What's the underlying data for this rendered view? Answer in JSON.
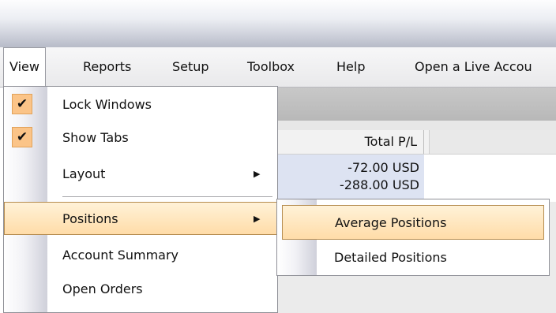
{
  "menubar": {
    "items": [
      {
        "label": "View"
      },
      {
        "label": "Reports"
      },
      {
        "label": "Setup"
      },
      {
        "label": "Toolbox"
      },
      {
        "label": "Help"
      },
      {
        "label": "Open a Live Accou"
      }
    ]
  },
  "background": {
    "total_pl_header": "Total P/L",
    "values": [
      "-72.00 USD",
      "-288.00 USD"
    ]
  },
  "view_menu": {
    "items": [
      {
        "label": "Lock Windows",
        "checked": true
      },
      {
        "label": "Show Tabs",
        "checked": true
      },
      {
        "label": "Layout",
        "has_submenu": true
      },
      {
        "label": "Positions",
        "has_submenu": true,
        "highlighted": true
      },
      {
        "label": "Account Summary"
      },
      {
        "label": "Open Orders"
      }
    ],
    "check_glyph": "✔",
    "arrow_glyph": "▶"
  },
  "positions_submenu": {
    "items": [
      {
        "label": "Average Positions",
        "highlighted": true
      },
      {
        "label": "Detailed Positions"
      }
    ]
  },
  "colors": {
    "highlight": "#ffdca8",
    "check_bg": "#fbc488"
  }
}
